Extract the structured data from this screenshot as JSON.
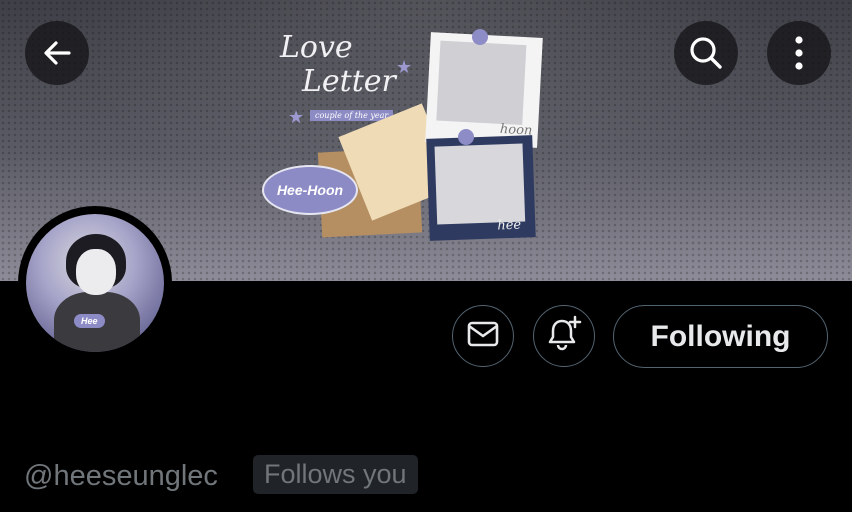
{
  "header": {
    "back_icon": "arrow-left-icon",
    "search_icon": "search-icon",
    "more_icon": "more-vertical-icon"
  },
  "banner": {
    "title_line1": "Love",
    "title_line2": "Letter",
    "tagline": "couple of the year",
    "oval_text": "Hee-Hoon",
    "photo1_caption": "hoon",
    "photo2_caption": "hee",
    "accent_color": "#8d8bc6"
  },
  "profile": {
    "avatar_label": "Hee",
    "handle": "@heeseunglec",
    "follows_you": "Follows you"
  },
  "actions": {
    "message_icon": "envelope-icon",
    "notify_icon": "bell-plus-icon",
    "follow_label": "Following"
  },
  "colors": {
    "background": "#000000",
    "button_border": "#536471",
    "primary_text": "#e7e9ea",
    "secondary_text": "#71767b",
    "badge_bg": "#202327"
  }
}
